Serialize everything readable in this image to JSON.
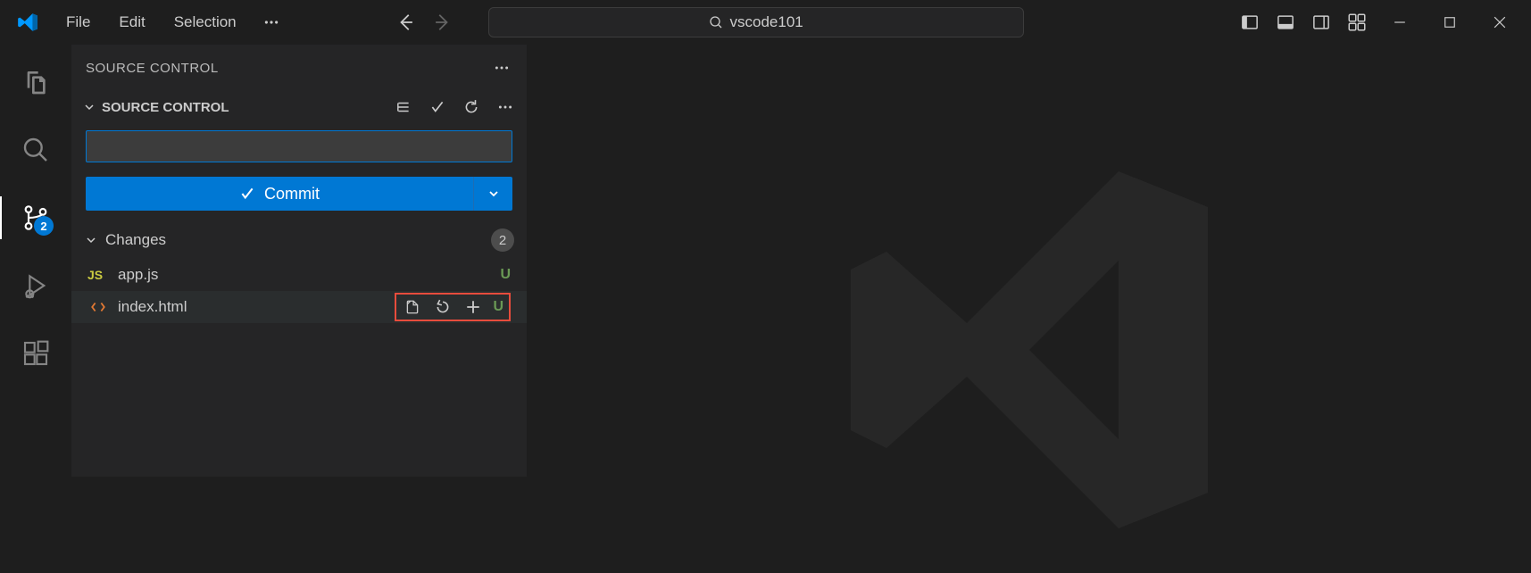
{
  "menu": {
    "file": "File",
    "edit": "Edit",
    "selection": "Selection"
  },
  "search": {
    "text": "vscode101"
  },
  "sidebar": {
    "title": "SOURCE CONTROL",
    "section_title": "SOURCE CONTROL",
    "commit_label": "Commit",
    "changes_label": "Changes",
    "changes_count": "2",
    "scm_badge": "2",
    "files": [
      {
        "icon_label": "JS",
        "name": "app.js",
        "status": "U"
      },
      {
        "icon_label": "<>",
        "name": "index.html",
        "status": "U"
      }
    ]
  }
}
